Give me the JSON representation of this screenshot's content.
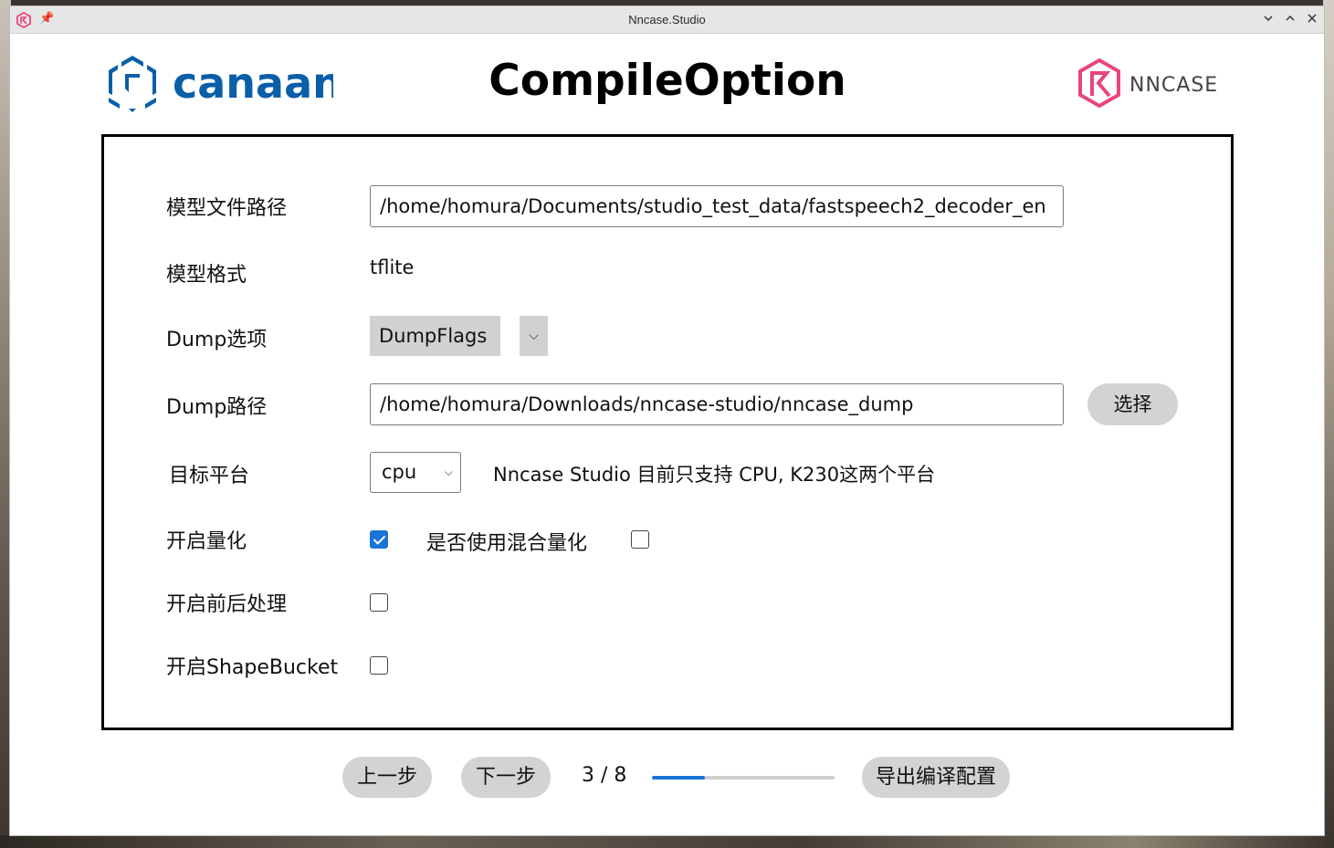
{
  "window": {
    "title": "Nncase.Studio",
    "controls": [
      "minimize",
      "maximize",
      "close"
    ]
  },
  "header": {
    "brand_text": "canaan",
    "title": "CompileOption",
    "product_logo_text": "NNCASE",
    "colors": {
      "brand_blue": "#0b5ea8",
      "nncase_pink": "#e8457c"
    }
  },
  "form": {
    "model_path": {
      "label": "模型文件路径",
      "value": "/home/homura/Documents/studio_test_data/fastspeech2_decoder_en"
    },
    "model_format": {
      "label": "模型格式",
      "value": "tflite"
    },
    "dump_option": {
      "label": "Dump选项",
      "value": "DumpFlags"
    },
    "dump_path": {
      "label": "Dump路径",
      "value": "/home/homura/Downloads/nncase-studio/nncase_dump",
      "button": "选择"
    },
    "target": {
      "label": "目标平台",
      "value": "cpu",
      "note": "Nncase Studio 目前只支持 CPU, K230这两个平台"
    },
    "quant": {
      "label": "开启量化",
      "checked": true,
      "mixed_label": "是否使用混合量化",
      "mixed_checked": false
    },
    "pre_post": {
      "label": "开启前后处理",
      "checked": false
    },
    "shape_bucket": {
      "label": "开启ShapeBucket",
      "checked": false
    }
  },
  "footer": {
    "prev": "上一步",
    "next": "下一步",
    "page": "3 / 8",
    "progress": 0.29,
    "export": "导出编译配置",
    "accent": "#1a73d6"
  }
}
